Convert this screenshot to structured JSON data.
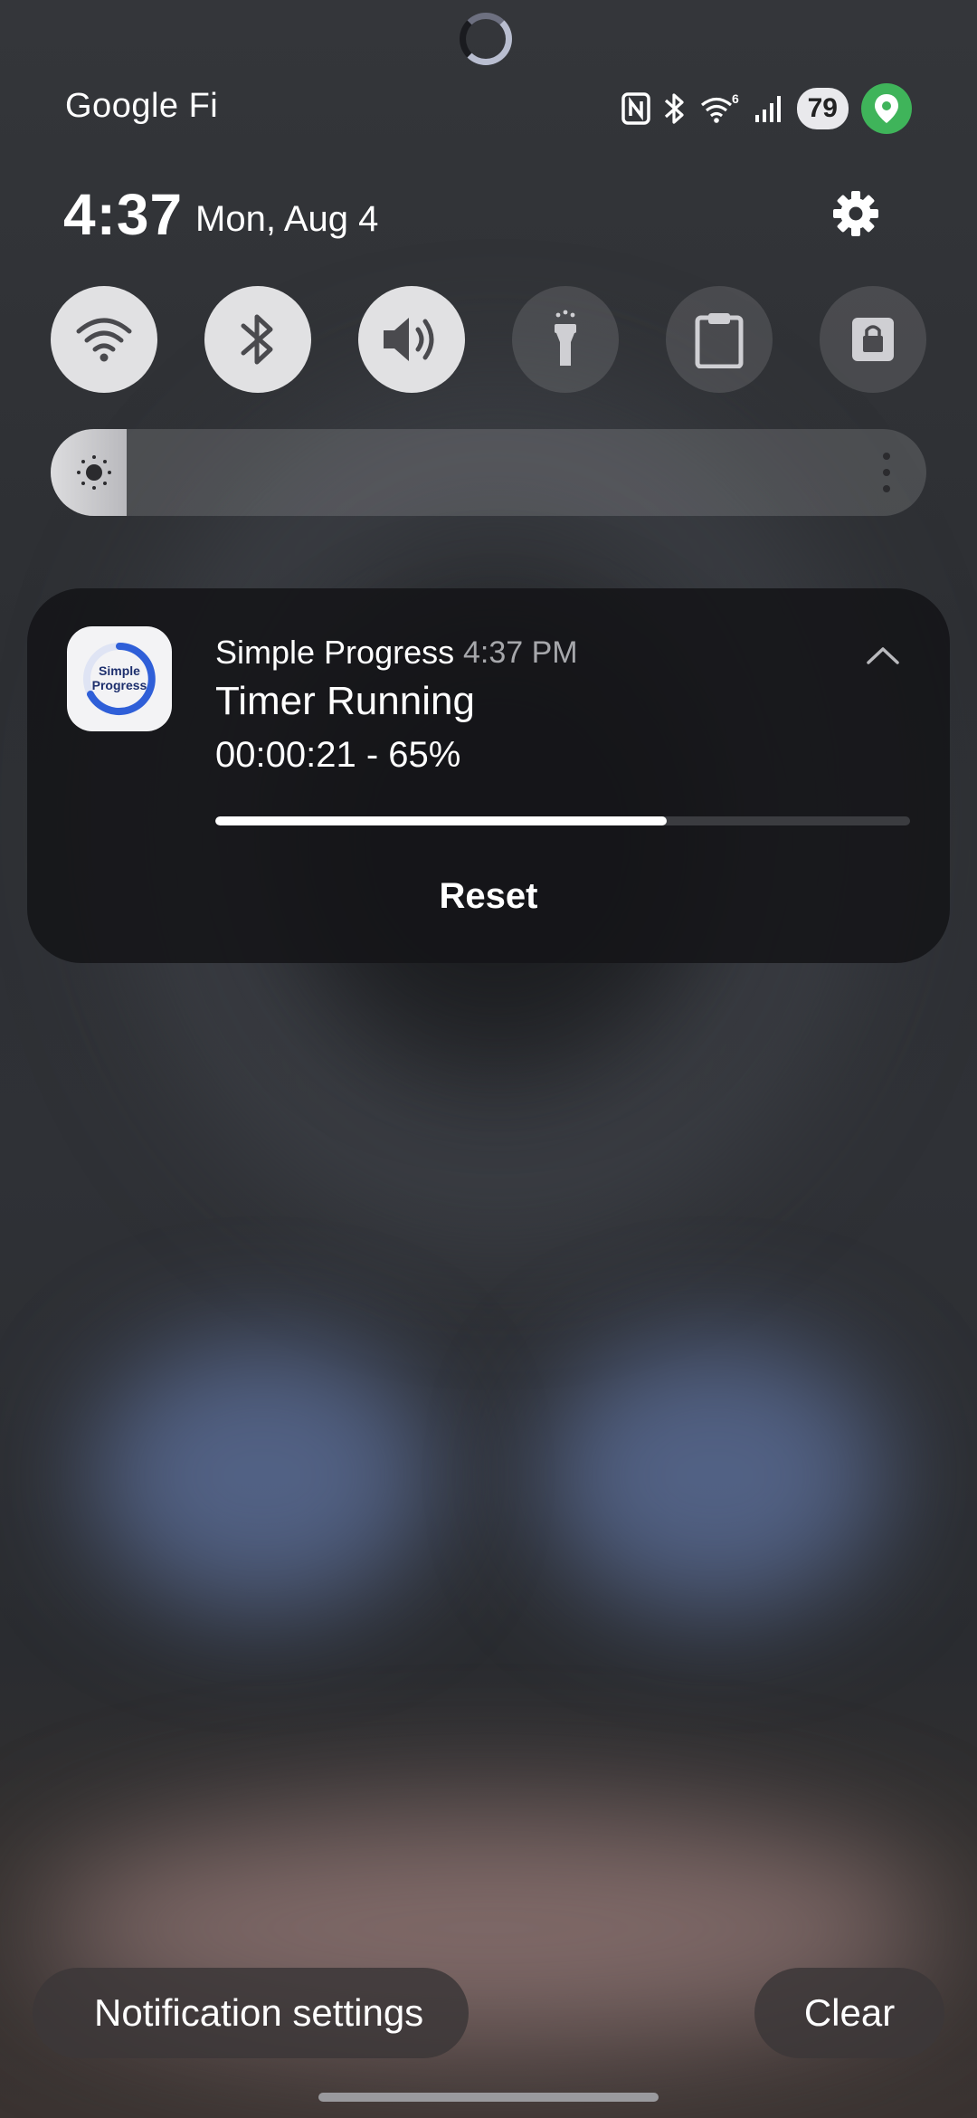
{
  "status_bar": {
    "carrier": "Google Fi",
    "battery": "79",
    "icons": [
      "nfc-icon",
      "bluetooth-icon",
      "wifi-6-icon",
      "cellular-signal-icon",
      "location-icon"
    ]
  },
  "header": {
    "time": "4:37",
    "date": "Mon, Aug 4",
    "settings_icon": "gear-icon"
  },
  "quick_tiles": [
    {
      "name": "wifi",
      "icon": "wifi-icon",
      "state": "on"
    },
    {
      "name": "bluetooth",
      "icon": "bluetooth-icon",
      "state": "on"
    },
    {
      "name": "sound",
      "icon": "speaker-icon",
      "state": "on"
    },
    {
      "name": "flashlight",
      "icon": "flashlight-icon",
      "state": "off"
    },
    {
      "name": "clipboard",
      "icon": "clipboard-icon",
      "state": "off"
    },
    {
      "name": "secure-folder",
      "icon": "lock-icon",
      "state": "off"
    }
  ],
  "brightness": {
    "level": 0.05
  },
  "notification": {
    "app_name": "Simple Progress",
    "app_icon_text": "Simple Progress",
    "time": "4:37 PM",
    "title": "Timer Running",
    "text": "00:00:21 - 65%",
    "progress": 0.65,
    "action": "Reset"
  },
  "footer": {
    "notification_settings": "Notification settings",
    "clear": "Clear"
  },
  "colors": {
    "location_badge": "#3fb45a",
    "tile_on": "#e1e1e3",
    "progress_fill": "#ffffff",
    "app_icon_blue": "#2f5fd8"
  }
}
